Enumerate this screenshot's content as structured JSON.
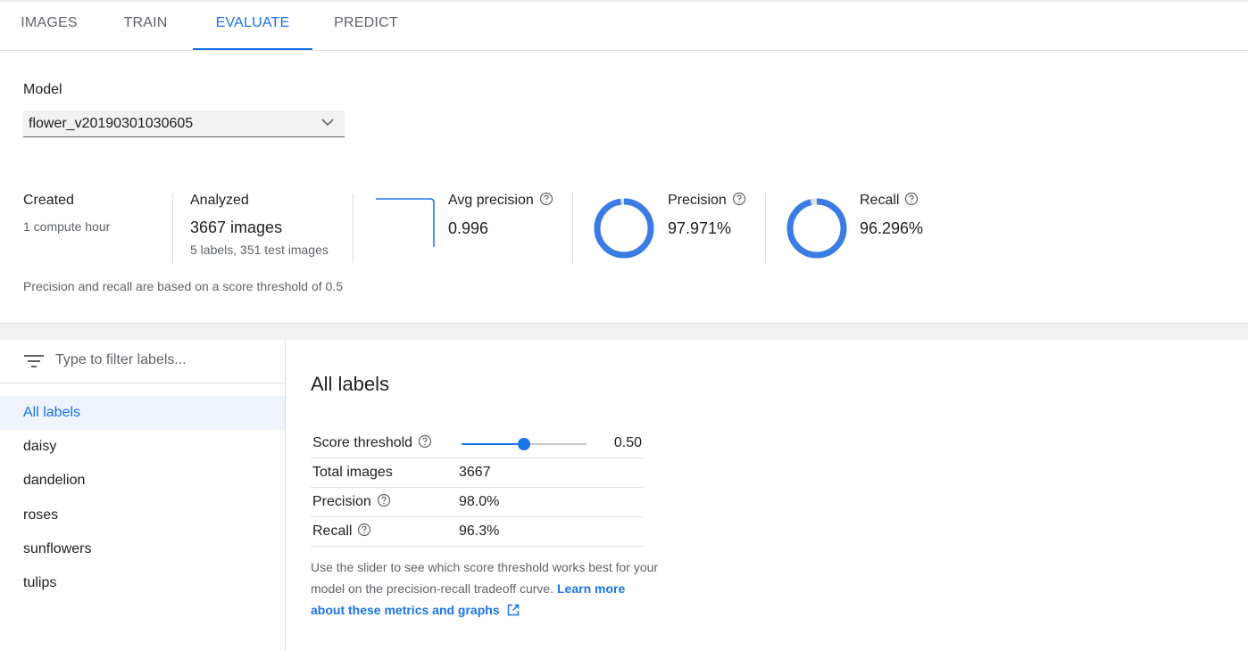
{
  "tabs": [
    {
      "label": "IMAGES"
    },
    {
      "label": "TRAIN"
    },
    {
      "label": "EVALUATE",
      "active": true
    },
    {
      "label": "PREDICT"
    }
  ],
  "model": {
    "label": "Model",
    "selected": "flower_v20190301030605"
  },
  "stats": {
    "created": {
      "title": "Created",
      "value": "1 compute hour"
    },
    "analyzed": {
      "title": "Analyzed",
      "value": "3667 images",
      "sub": "5 labels, 351 test images"
    },
    "avg_precision": {
      "title": "Avg precision",
      "value": "0.996"
    },
    "precision": {
      "title": "Precision",
      "value": "97.971%",
      "fraction": 0.97971
    },
    "recall": {
      "title": "Recall",
      "value": "96.296%",
      "fraction": 0.96296
    }
  },
  "threshold_note": "Precision and recall are based on a score threshold of 0.5",
  "filter": {
    "placeholder": "Type to filter labels..."
  },
  "labels": [
    {
      "label": "All labels",
      "active": true
    },
    {
      "label": "daisy"
    },
    {
      "label": "dandelion"
    },
    {
      "label": "roses"
    },
    {
      "label": "sunflowers"
    },
    {
      "label": "tulips"
    }
  ],
  "detail": {
    "title": "All labels",
    "score_threshold_label": "Score threshold",
    "score_threshold_value": "0.50",
    "slider_fraction": 0.5,
    "total_images_label": "Total images",
    "total_images_value": "3667",
    "precision_label": "Precision",
    "precision_value": "98.0%",
    "recall_label": "Recall",
    "recall_value": "96.3%",
    "description": "Use the slider to see which score threshold works best for your model on the precision-recall tradeoff curve.",
    "learn_more": "Learn more about these metrics and graphs"
  },
  "colors": {
    "accent": "#1a73e8",
    "ring": "#3b7ce4",
    "ring_track": "#e0e0e0"
  },
  "icons": [
    "chevron-down-icon",
    "help-icon",
    "filter-icon",
    "open-in-new-icon"
  ]
}
